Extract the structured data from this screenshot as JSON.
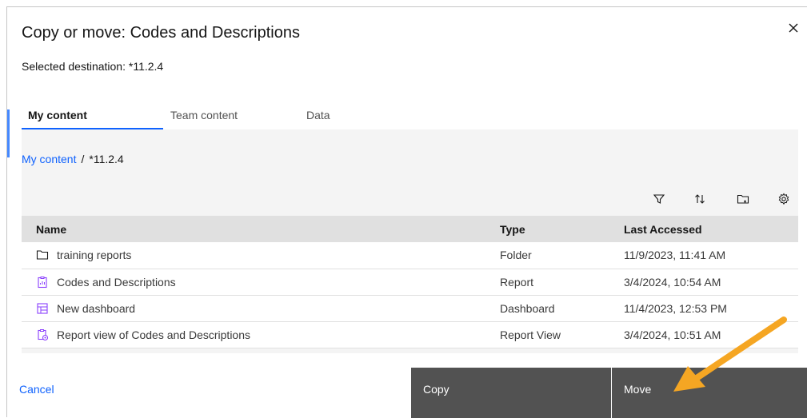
{
  "dialog": {
    "title": "Copy or move: Codes and Descriptions",
    "selected_destination": "Selected destination: *11.2.4"
  },
  "tabs": [
    {
      "label": "My content",
      "active": true
    },
    {
      "label": "Team content",
      "active": false
    },
    {
      "label": "Data",
      "active": false
    }
  ],
  "breadcrumb": {
    "root": "My content",
    "separator": "/",
    "current": "*11.2.4"
  },
  "toolbar": {
    "icons": [
      "filter-icon",
      "sort-icon",
      "new-folder-icon",
      "settings-icon"
    ]
  },
  "table": {
    "headers": [
      "Name",
      "Type",
      "Last Accessed"
    ],
    "rows": [
      {
        "icon": "folder-icon",
        "name": "training reports",
        "type": "Folder",
        "last_accessed": "11/9/2023, 11:41 AM"
      },
      {
        "icon": "report-icon",
        "name": "Codes and Descriptions",
        "type": "Report",
        "last_accessed": "3/4/2024, 10:54 AM"
      },
      {
        "icon": "dashboard-icon",
        "name": "New dashboard",
        "type": "Dashboard",
        "last_accessed": "11/4/2023, 12:53 PM"
      },
      {
        "icon": "report-view-icon",
        "name": "Report view of Codes and Descriptions",
        "type": "Report View",
        "last_accessed": "3/4/2024, 10:51 AM"
      }
    ]
  },
  "footer": {
    "cancel": "Cancel",
    "copy": "Copy",
    "move": "Move"
  },
  "colors": {
    "accent": "#0f62fe",
    "button_bg": "#525252",
    "panel_bg": "#f4f4f4",
    "header_bg": "#e0e0e0",
    "arrow": "#f5a623",
    "icon_purple": "#8a3ffc"
  }
}
